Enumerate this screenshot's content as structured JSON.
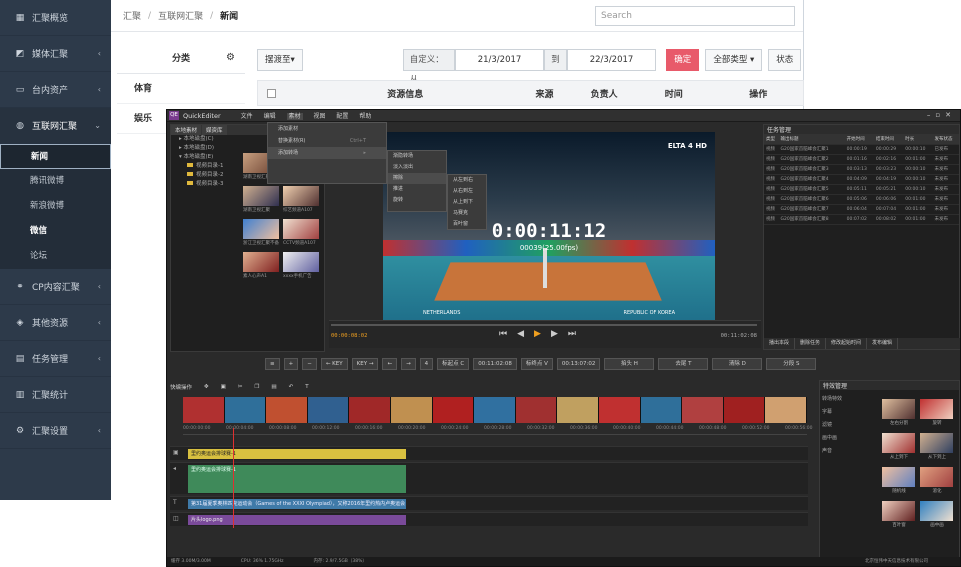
{
  "sidebar": {
    "items": [
      {
        "label": "汇聚概览",
        "icon": "grid-icon",
        "arrow": ""
      },
      {
        "label": "媒体汇聚",
        "icon": "media-icon",
        "arrow": "‹"
      },
      {
        "label": "台内资产",
        "icon": "tv-icon",
        "arrow": "‹"
      },
      {
        "label": "互联网汇聚",
        "icon": "globe-icon",
        "arrow": "⌄"
      },
      {
        "label": "CP内容汇聚",
        "icon": "cp-icon",
        "arrow": "‹"
      },
      {
        "label": "其他资源",
        "icon": "box-icon",
        "arrow": "‹"
      },
      {
        "label": "任务管理",
        "icon": "task-icon",
        "arrow": "‹"
      },
      {
        "label": "汇聚统计",
        "icon": "chart-icon",
        "arrow": ""
      },
      {
        "label": "汇聚设置",
        "icon": "gear-icon",
        "arrow": "‹"
      }
    ],
    "subitems": [
      "新闻",
      "腾讯微博",
      "新浪微博",
      "微信",
      "论坛"
    ]
  },
  "breadcrumb": [
    "汇聚",
    "互联网汇聚",
    "新闻"
  ],
  "search": {
    "placeholder": "Search"
  },
  "category": {
    "title": "分类",
    "rows": [
      "体育",
      "娱乐"
    ]
  },
  "toolbar": {
    "send_to": "摆渡至▾",
    "custom_from": "自定义：从",
    "date_from": "21/3/2017",
    "to": "到",
    "date_to": "22/3/2017",
    "confirm": "确定",
    "type": "全部类型 ▾",
    "status": "状态"
  },
  "table": {
    "headers": [
      "资源信息",
      "来源",
      "负责人",
      "时间",
      "操作"
    ]
  },
  "qe": {
    "logo": "QE",
    "app": "QuickEditer",
    "menu": [
      "文件",
      "编辑",
      "素材",
      "视图",
      "配置",
      "帮助"
    ],
    "lib_tabs": [
      "本地素材",
      "媒资库"
    ],
    "tree": [
      "本地磁盘(C)",
      "本地磁盘(D)",
      "本地磁盘(E)",
      "视频目录-1",
      "视频目录-2",
      "视频目录-3"
    ],
    "thumb_labels": [
      "湖南卫视汇聚",
      "综艺频道A107",
      "湖南卫视汇聚",
      "综艺频道A107",
      "浙江卫视汇聚不备",
      "CCTV频道A107",
      "素人心声A1",
      "xxxx手机广告"
    ],
    "dropdown": [
      {
        "label": "添加素材",
        "shortcut": ""
      },
      {
        "label": "替换素材(R)",
        "shortcut": "Ctrl+T"
      },
      {
        "label": "添加转场",
        "shortcut": "▸"
      }
    ],
    "sub1": [
      "渐隐转场",
      "淡入淡出",
      "擦除",
      "推进",
      "旋转"
    ],
    "sub2": [
      "从左到右",
      "从右到左",
      "从上到下",
      "马赛克",
      "百叶窗"
    ],
    "timecode": "0:00:11:12",
    "fps": "00039(25.00fps)",
    "broadcaster": "ELTA 4 HD",
    "team_left": "NETHERLANDS",
    "team_right": "REPUBLIC OF KOREA",
    "tc_in": "00:00:08:02",
    "tc_out": "00:11:02:08",
    "tasks": {
      "title": "任务管理",
      "headers": [
        "类型",
        "输出标题",
        "开始时间",
        "结束时间",
        "时长",
        "发布状态"
      ],
      "rows": [
        [
          "视频",
          "G20国家首脑峰会汇聚1",
          "00:00:19",
          "00:00:29",
          "00:00:10",
          "已发布"
        ],
        [
          "视频",
          "G20国家首脑峰会汇聚2",
          "00:01:16",
          "00:02:16",
          "00:01:00",
          "未发布"
        ],
        [
          "视频",
          "G20国家首脑峰会汇聚3",
          "00:03:13",
          "00:03:23",
          "00:00:10",
          "未发布"
        ],
        [
          "视频",
          "G20国家首脑峰会汇聚4",
          "00:04:09",
          "00:04:19",
          "00:00:10",
          "未发布"
        ],
        [
          "视频",
          "G20国家首脑峰会汇聚5",
          "00:05:11",
          "00:05:21",
          "00:00:10",
          "未发布"
        ],
        [
          "视频",
          "G20国家首脑峰会汇聚6",
          "00:05:06",
          "00:06:06",
          "00:01:00",
          "未发布"
        ],
        [
          "视频",
          "G20国家首脑峰会汇聚7",
          "00:06:04",
          "00:07:04",
          "00:01:00",
          "未发布"
        ],
        [
          "视频",
          "G20国家首脑峰会汇聚8",
          "00:07:02",
          "00:08:02",
          "00:01:00",
          "未发布"
        ]
      ],
      "tabs": [
        "播出本段",
        "删除任务",
        "修改起始时间",
        "发布编辑"
      ]
    },
    "editbar": {
      "key1": "← KEY",
      "key2": "KEY →",
      "frames": "4",
      "mark_in": "标起点 C",
      "in_tc": "00:11:02:08",
      "mark_out": "标终点 V",
      "out_tc": "00:13:07:02",
      "btn1": "掐头 H",
      "btn2": "去尾 T",
      "btn3": "清除 D",
      "btn4": "分段 S"
    },
    "tl_title": "快编操作",
    "ruler": [
      "00:00:00:00",
      "00:00:04:00",
      "00:00:08:00",
      "00:00:12:00",
      "00:00:16:00",
      "00:00:20:00",
      "00:00:24:00",
      "00:00:28:00",
      "00:00:32:00",
      "00:00:36:00",
      "00:00:40:00",
      "00:00:44:00",
      "00:00:48:00",
      "00:00:52:00",
      "00:00:56:00"
    ],
    "clips": {
      "v1": "里约奥运会排球赛-1",
      "a1": "里约奥运会排球赛-1",
      "txt": "第31届夏季奥林匹克运动会（Games of the XXXI Olympiad），又称2016年里约热内卢奥运会",
      "img": "片头logo.png"
    },
    "effects": {
      "title": "特效管理",
      "list": [
        "转场特效",
        "字幕",
        "滤镜",
        "画中画",
        "声音"
      ],
      "labels": [
        "左右分割",
        "旋转",
        "从上到下",
        "从下到上",
        "随机线",
        "溶化",
        "百叶窗",
        "画中画"
      ]
    },
    "status": {
      "mem": "缓存 3.00M/3.00M",
      "cpu": "CPU: 36%   1.75GHz",
      "ram": "内存: 2.9/7.5GB（38%）",
      "company": "北京恒伟中天信息技术有限公司"
    }
  },
  "colors": {
    "sidebar": "#2d3a4a",
    "accent": "#e85a6a",
    "orange": "#f0a020"
  }
}
